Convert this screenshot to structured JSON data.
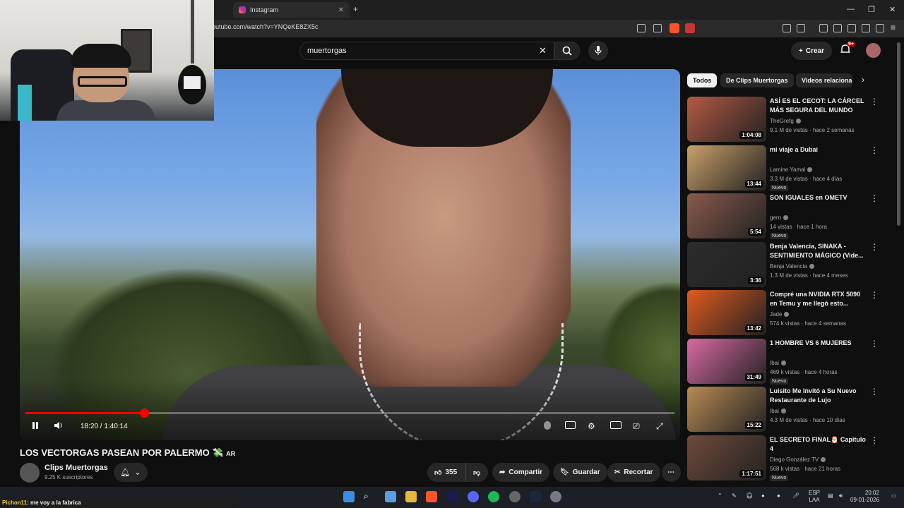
{
  "browser": {
    "tab_title": "Instagram",
    "url": "outube.com/watch?v=YNQeKE8ZX5c",
    "window_controls": [
      "—",
      "❐",
      "✕"
    ]
  },
  "header": {
    "search_value": "muertorgas",
    "create_label": "Crear",
    "notif_count": "9+"
  },
  "player": {
    "time": "18:20 / 1:40:14",
    "progress_fraction": 0.1829
  },
  "video": {
    "title": "LOS VECTORGAS PASEAN POR PALERMO",
    "title_suffix": "AR",
    "channel": "Clips Muertorgas",
    "subscribers": "9.25 K suscriptores",
    "likes": "355",
    "share_label": "Compartir",
    "save_label": "Guardar",
    "clip_label": "Recortar"
  },
  "chips": [
    "Todos",
    "De Clips Muertorgas",
    "Videos relacionados"
  ],
  "recommendations": [
    {
      "title": "ASÍ ES EL CECOT: LA CÁRCEL MÁS SEGURA DEL MUNDO",
      "channel": "TheGrefg",
      "meta": "9.1 M de vistas · hace 2 semanas",
      "duration": "1:04:08",
      "badge": "",
      "color": "#b55a44"
    },
    {
      "title": "mi viaje a Dubai",
      "channel": "Lamine Yamal",
      "meta": "3.3 M de vistas · hace 4 días",
      "duration": "13:44",
      "badge": "Nuevo",
      "color": "#caa06a"
    },
    {
      "title": "SON IGUALES en OMETV",
      "channel": "gero",
      "meta": "14 vistas · hace 1 hora",
      "duration": "5:54",
      "badge": "Nuevo",
      "color": "#8a5a4d"
    },
    {
      "title": "Benja Valencia, SINAKA - SENTIMIENTO MÁGICO (Vide...",
      "channel": "Benja Valencia",
      "meta": "1.3 M de vistas · hace 4 meses",
      "duration": "3:36",
      "badge": "",
      "color": "#2b2b2b"
    },
    {
      "title": "Compré una NVIDIA RTX 5090 en Temu y me llegó esto...",
      "channel": "Jade",
      "meta": "574 k vistas · hace 4 semanas",
      "duration": "13:42",
      "badge": "",
      "color": "#e05a1e"
    },
    {
      "title": "1 HOMBRE VS 6 MUJERES",
      "channel": "Ibai",
      "meta": "469 k vistas · hace 4 horas",
      "duration": "31:49",
      "badge": "Nuevo",
      "color": "#d96aa3"
    },
    {
      "title": "Luisito Me Invitó a Su Nuevo Restaurante de Lujo",
      "channel": "Ibai",
      "meta": "4.3 M de vistas · hace 10 días",
      "duration": "15:22",
      "badge": "",
      "color": "#b98b54"
    },
    {
      "title": "EL SECRETO FINAL🎅 Capítulo 4",
      "channel": "Diego González TV",
      "meta": "568 k vistas · hace 21 horas",
      "duration": "1:17:51",
      "badge": "Nuevo",
      "color": "#6e4a3a"
    }
  ],
  "chat": {
    "user": "Pichon11",
    "message": ": me voy a la fabrica"
  },
  "tray": {
    "lang": "ESP",
    "layout": "LAA",
    "time": "20:02",
    "date": "09-01-2026"
  }
}
